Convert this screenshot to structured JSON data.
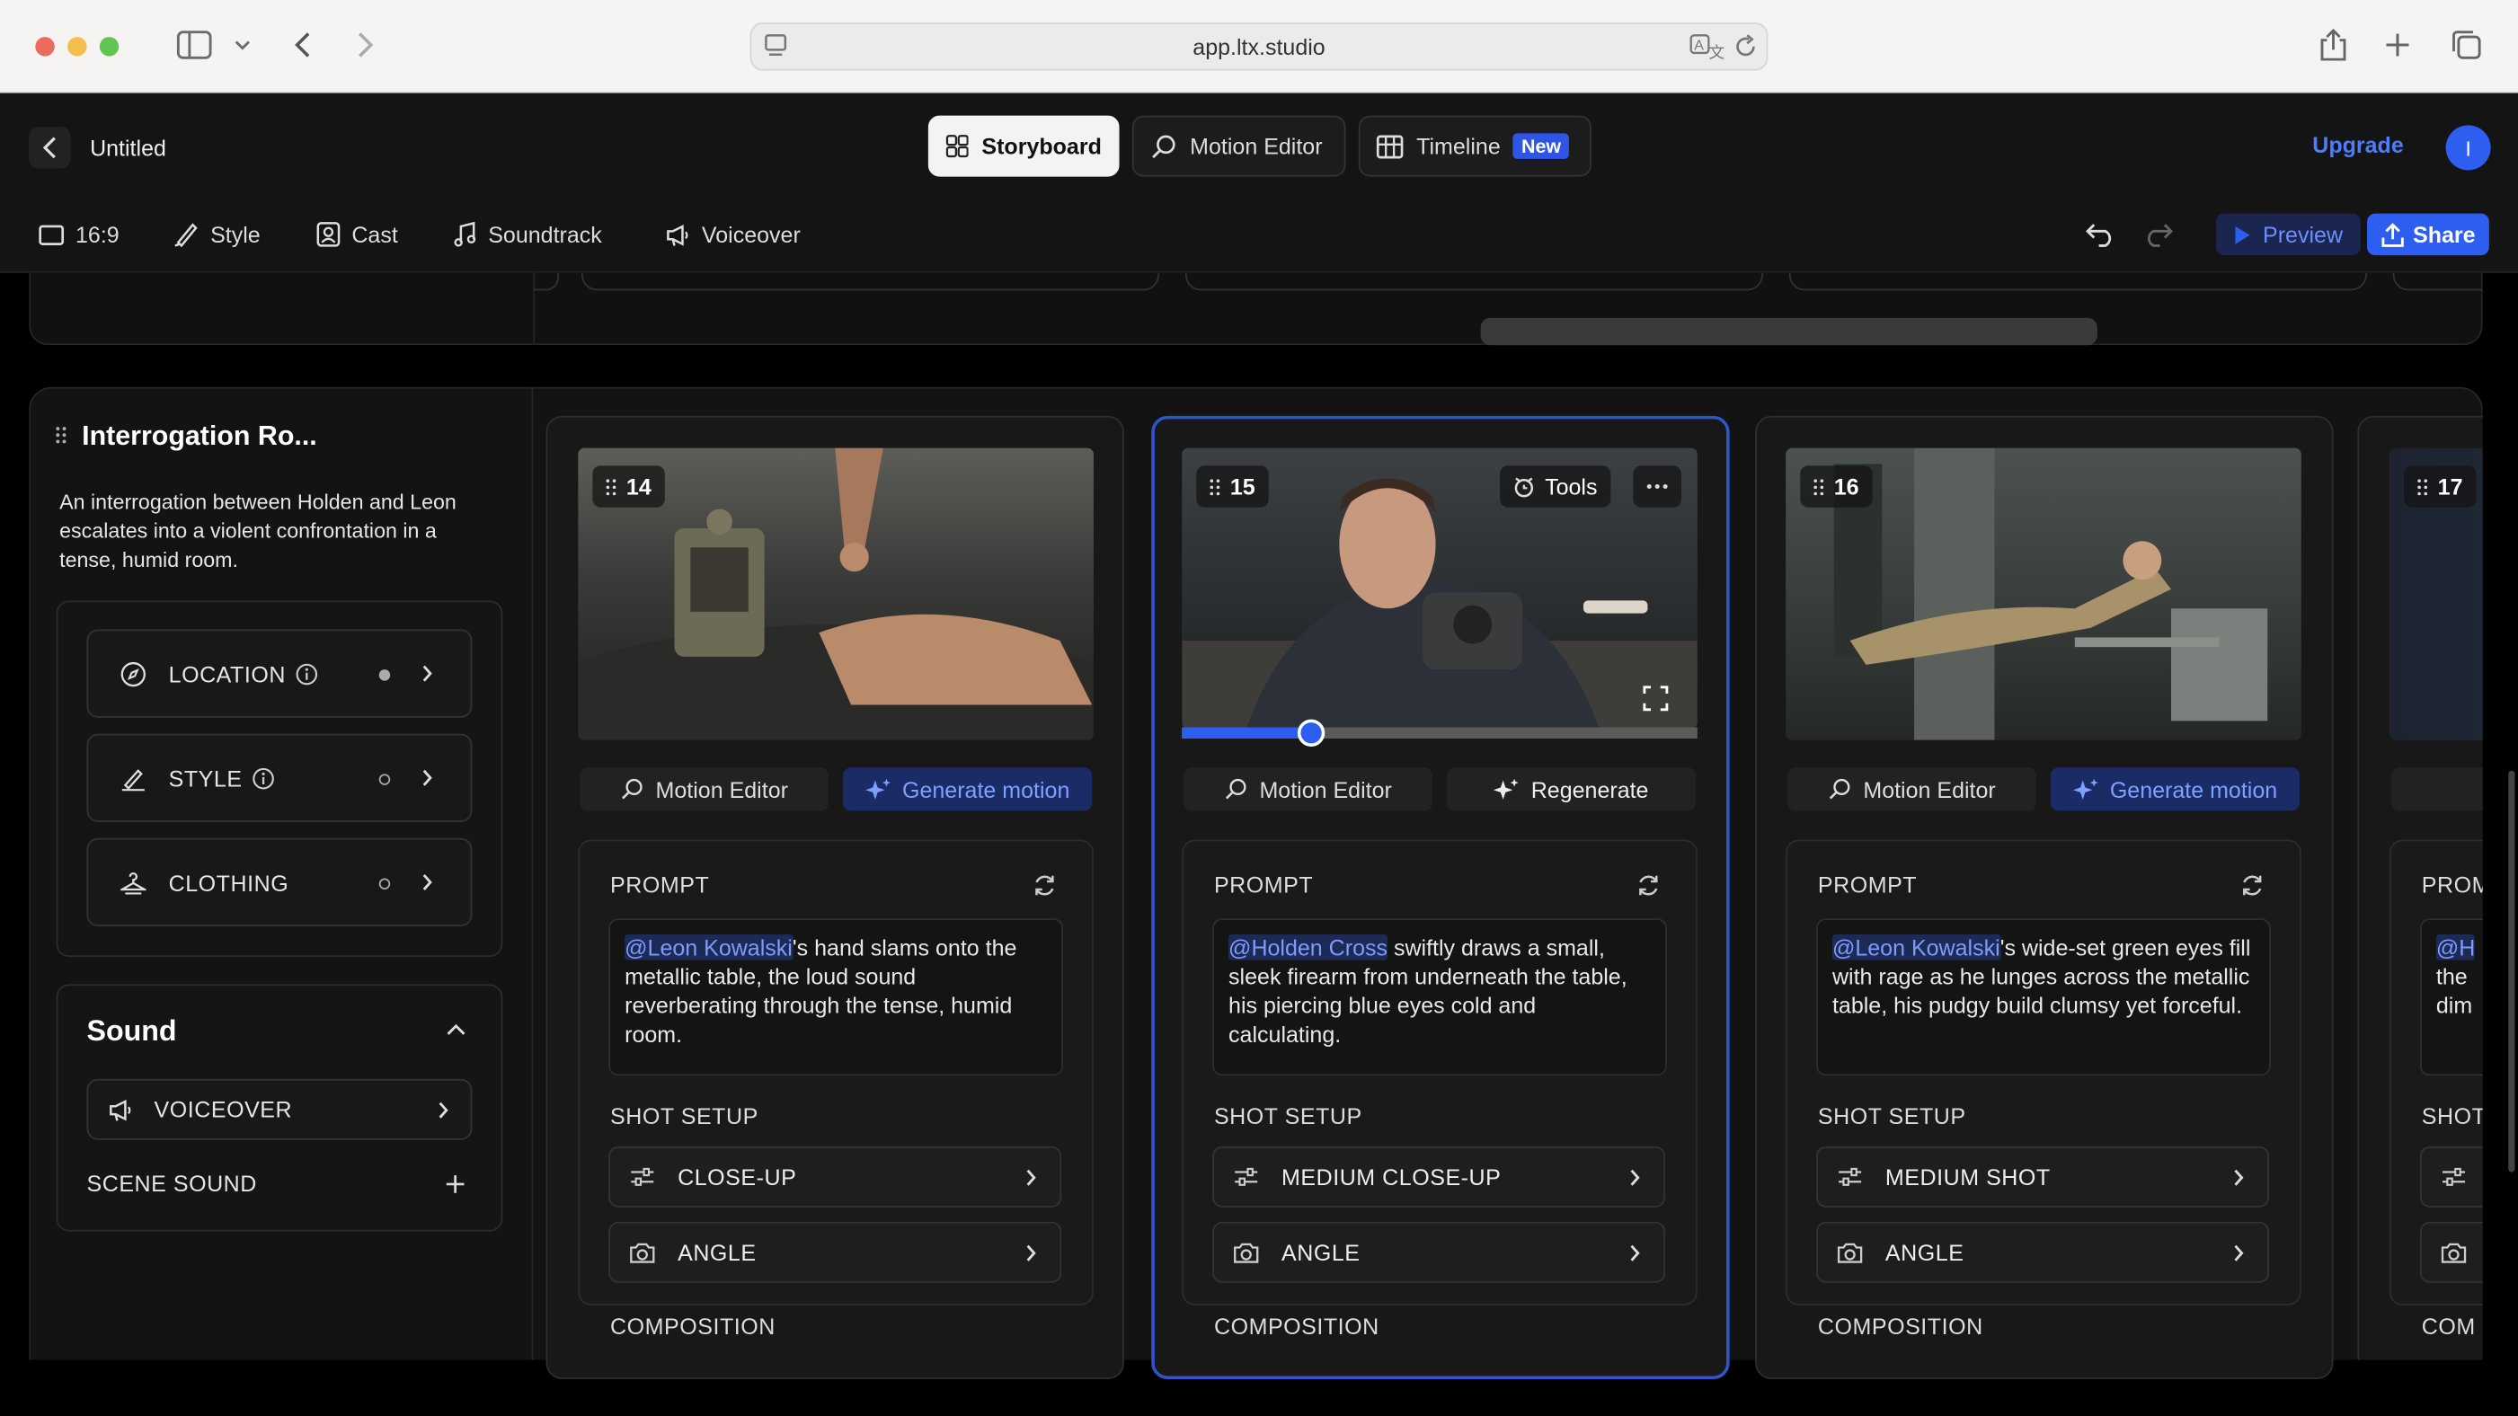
{
  "browser": {
    "url": "app.ltx.studio"
  },
  "header": {
    "back_label": "Untitled",
    "tabs": [
      {
        "label": "Storyboard",
        "active": true
      },
      {
        "label": "Motion Editor",
        "active": false
      },
      {
        "label": "Timeline",
        "active": false,
        "badge": "New"
      }
    ],
    "upgrade_label": "Upgrade",
    "avatar_initial": "I"
  },
  "toolbar": {
    "aspect_label": "16:9",
    "style_label": "Style",
    "cast_label": "Cast",
    "soundtrack_label": "Soundtrack",
    "voiceover_label": "Voiceover",
    "preview_label": "Preview",
    "share_label": "Share"
  },
  "scene": {
    "title": "Interrogation Ro...",
    "description": "An interrogation between Holden and Leon escalates into a violent confrontation in a tense, humid room.",
    "settings": [
      {
        "label": "LOCATION",
        "info": true,
        "dot": "filled"
      },
      {
        "label": "STYLE",
        "info": true,
        "dot": "empty"
      },
      {
        "label": "CLOTHING",
        "info": false,
        "dot": "empty"
      }
    ],
    "sound": {
      "title": "Sound",
      "voiceover_label": "VOICEOVER",
      "scene_sound_label": "SCENE SOUND"
    }
  },
  "shots": [
    {
      "number": "14",
      "motion_editor_label": "Motion Editor",
      "action_label": "Generate motion",
      "prompt_label": "PROMPT",
      "mention": "@Leon Kowalski",
      "prompt_rest": "'s hand slams onto the metallic table, the loud sound reverberating through the tense, humid room.",
      "shot_setup_label": "SHOT SETUP",
      "shot_type": "CLOSE-UP",
      "angle_label": "ANGLE",
      "composition_label": "COMPOSITION"
    },
    {
      "number": "15",
      "tools_label": "Tools",
      "motion_editor_label": "Motion Editor",
      "action_label": "Regenerate",
      "prompt_label": "PROMPT",
      "mention": "@Holden Cross",
      "prompt_rest": " swiftly draws a small, sleek firearm from underneath the table, his piercing blue eyes cold and calculating.",
      "shot_setup_label": "SHOT SETUP",
      "shot_type": "MEDIUM CLOSE-UP",
      "angle_label": "ANGLE",
      "composition_label": "COMPOSITION",
      "playback_progress": 0.25
    },
    {
      "number": "16",
      "motion_editor_label": "Motion Editor",
      "action_label": "Generate motion",
      "prompt_label": "PROMPT",
      "mention": "@Leon Kowalski",
      "prompt_rest": "'s wide-set green eyes fill with rage as he lunges across the metallic table, his pudgy build clumsy yet forceful.",
      "shot_setup_label": "SHOT SETUP",
      "shot_type": "MEDIUM SHOT",
      "angle_label": "ANGLE",
      "composition_label": "COMPOSITION"
    },
    {
      "number": "17",
      "partial": {
        "prompt_label": "PROM",
        "mention": "@H",
        "line2": "the",
        "line3": "dim",
        "shot_setup_label": "SHOT",
        "composition_label": "COM"
      }
    }
  ],
  "colors": {
    "accent": "#2e5ef0",
    "selected_border": "#2f55c9",
    "mention_text": "#7c9cff"
  }
}
